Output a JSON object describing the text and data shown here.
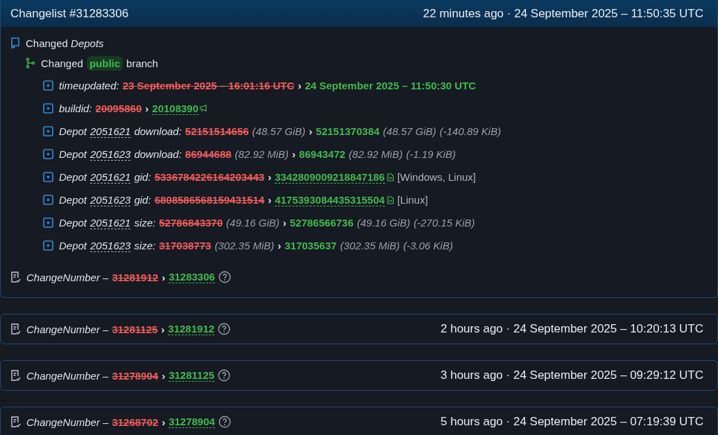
{
  "changelist": {
    "title": "Changelist #31283306",
    "time": "22 minutes ago · 24 September 2025 – 11:50:35 UTC",
    "section": {
      "label": "Changed",
      "name": "Depots"
    },
    "branch": {
      "prefix": "Changed",
      "name": "public",
      "suffix": "branch"
    },
    "changes": [
      {
        "kind": "plain",
        "arrow": "›",
        "key": "timeupdated:",
        "old": "23 September 2025 – 16:01:16 UTC",
        "new": "24 September 2025 – 11:50:30 UTC",
        "linked": false
      },
      {
        "kind": "build",
        "arrow": "›",
        "key": "buildid:",
        "old": "20095860",
        "new": "20108390",
        "linked": true
      },
      {
        "kind": "size",
        "depot_label": "Depot",
        "depot": "2051621",
        "arrow": "›",
        "key": "download:",
        "old": "52151514656",
        "old_size": "(48.57 GiB)",
        "new": "52151370384",
        "new_size": "(48.57 GiB)",
        "diff": "(-140.89 KiB)",
        "linked": false
      },
      {
        "kind": "size",
        "depot_label": "Depot",
        "depot": "2051623",
        "arrow": "›",
        "key": "download:",
        "old": "86944688",
        "old_size": "(82.92 MiB)",
        "new": "86943472",
        "new_size": "(82.92 MiB)",
        "diff": "(-1.19 KiB)",
        "linked": false
      },
      {
        "kind": "manifest",
        "depot_label": "Depot",
        "depot": "2051621",
        "arrow": "›",
        "key": "gid:",
        "old": "5336784226164203443",
        "new": "3342809009218847186",
        "platforms": "[Windows, Linux]",
        "linked": true
      },
      {
        "kind": "manifest",
        "depot_label": "Depot",
        "depot": "2051623",
        "arrow": "›",
        "key": "gid:",
        "old": "6808586568159431514",
        "new": "4175393084435315504",
        "platforms": "[Linux]",
        "linked": true
      },
      {
        "kind": "size",
        "depot_label": "Depot",
        "depot": "2051621",
        "arrow": "›",
        "key": "size:",
        "old": "52786843370",
        "old_size": "(49.16 GiB)",
        "new": "52786566736",
        "new_size": "(49.16 GiB)",
        "diff": "(-270.15 KiB)",
        "linked": false
      },
      {
        "kind": "size",
        "depot_label": "Depot",
        "depot": "2051623",
        "arrow": "›",
        "key": "size:",
        "old": "317038773",
        "old_size": "(302.35 MiB)",
        "new": "317035637",
        "new_size": "(302.35 MiB)",
        "diff": "(-3.06 KiB)",
        "linked": false
      }
    ],
    "change_number": {
      "label": "ChangeNumber –",
      "old": "31281912",
      "arrow": "›",
      "new": "31283306"
    }
  },
  "history": [
    {
      "label": "ChangeNumber –",
      "old": "31281125",
      "arrow": "›",
      "new": "31281912",
      "time": "2 hours ago · 24 September 2025 – 10:20:13 UTC"
    },
    {
      "label": "ChangeNumber –",
      "old": "31278904",
      "arrow": "›",
      "new": "31281125",
      "time": "3 hours ago · 24 September 2025 – 09:29:12 UTC"
    },
    {
      "label": "ChangeNumber –",
      "old": "31268702",
      "arrow": "›",
      "new": "31278904",
      "time": "5 hours ago · 24 September 2025 – 07:19:39 UTC"
    }
  ]
}
